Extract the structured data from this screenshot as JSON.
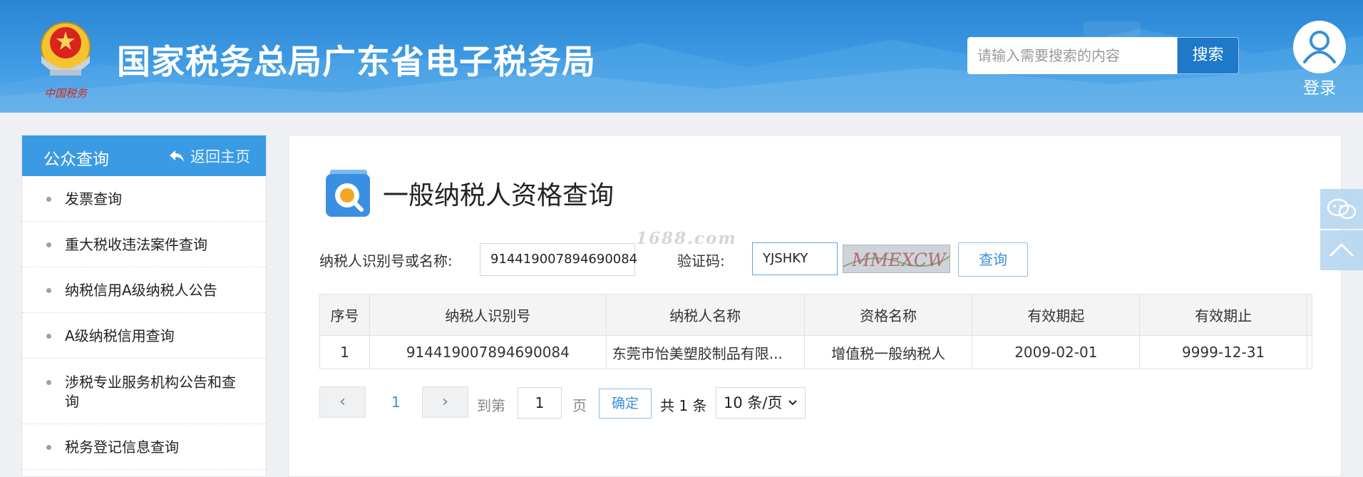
{
  "header": {
    "site_title": "国家税务总局广东省电子税务局",
    "emblem_text": "中国税务",
    "search_placeholder": "请输入需要搜索的内容",
    "search_button": "搜索",
    "login_label": "登录"
  },
  "sidebar": {
    "title": "公众查询",
    "back_label": "返回主页",
    "items": [
      {
        "label": "发票查询"
      },
      {
        "label": "重大税收违法案件查询"
      },
      {
        "label": "纳税信用A级纳税人公告"
      },
      {
        "label": "A级纳税信用查询"
      },
      {
        "label": "涉税专业服务机构公告和查询"
      },
      {
        "label": "税务登记信息查询"
      }
    ]
  },
  "main": {
    "page_title": "一般纳税人资格查询",
    "form": {
      "taxpayer_label": "纳税人识别号或名称:",
      "taxpayer_value": "914419007894690084",
      "captcha_label": "验证码:",
      "captcha_value": "YJSHKY",
      "captcha_image_text": "MMEXCW",
      "query_button": "查询"
    },
    "watermark": "1688.com",
    "table": {
      "columns": [
        "序号",
        "纳税人识别号",
        "纳税人名称",
        "资格名称",
        "有效期起",
        "有效期止"
      ],
      "rows": [
        [
          "1",
          "914419007894690084",
          "东莞市怡美塑胶制品有限...",
          "增值税一般纳税人",
          "2009-02-01",
          "9999-12-31"
        ]
      ]
    },
    "pagination": {
      "prev_icon": "‹",
      "next_icon": "›",
      "current_page": "1",
      "goto_label": "到第",
      "goto_value": "1",
      "page_unit": "页",
      "confirm_button": "确定",
      "total_text": "共 1 条",
      "page_size": "10 条/页"
    }
  },
  "colors": {
    "header_blue": "#2a86d3",
    "sidebar_head": "#3a9be4",
    "accent": "#3a8fd6"
  }
}
